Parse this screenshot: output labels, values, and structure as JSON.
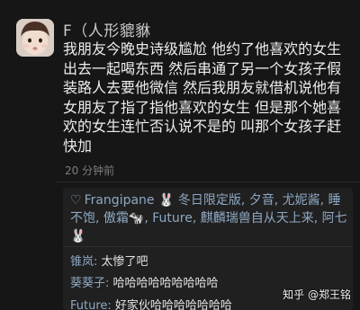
{
  "post": {
    "username": "F（人形貔貅",
    "text": "我朋友今晚史诗级尴尬 他约了他喜欢的女生出去一起喝东西 然后串通了另一个女孩子假装路人去要他微信 然后我朋友就借机说他有女朋友了指了指他喜欢的女生 但是那个她喜欢的女生连忙否认说不是的 叫那个女孩子赶快加",
    "time": "20 分钟前"
  },
  "likes": {
    "icon": "heart-icon",
    "text": "Frangipane 🐰 冬日限定版, 夕音, 尤妮酱, 睡不饱, 傲霜🐄, Future, 麒麟瑞兽自从天上来, 阿七🐰"
  },
  "comments": [
    {
      "author": "锥岚:",
      "text": "太惨了吧"
    },
    {
      "author": "葵葵子:",
      "text": "哈哈哈哈哈哈哈哈哈"
    },
    {
      "author": "Future:",
      "text": "好家伙哈哈哈哈哈哈哈"
    }
  ],
  "watermark": "知乎 @郑王铭",
  "colors": {
    "background": "#161616",
    "name_link": "#8ea8c3",
    "text": "#ededed",
    "muted": "#7d7d7d"
  }
}
